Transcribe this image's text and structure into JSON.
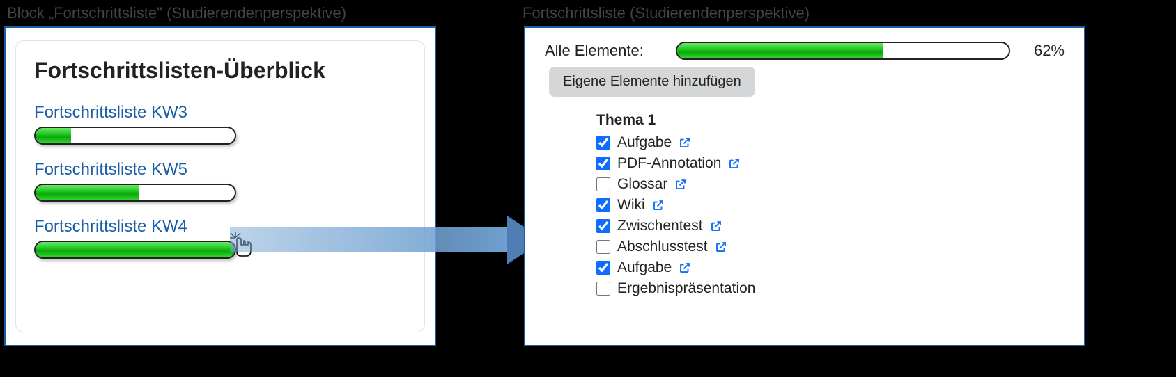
{
  "captions": {
    "left": "Block „Fortschrittsliste\" (Studierendenperspektive)",
    "right": "Fortschrittsliste (Studierendenperspektive)"
  },
  "overview": {
    "title": "Fortschrittslisten-Überblick",
    "items": [
      {
        "label": "Fortschrittsliste KW3",
        "progress": 18
      },
      {
        "label": "Fortschrittsliste KW5",
        "progress": 52
      },
      {
        "label": "Fortschrittsliste KW4",
        "progress": 100
      }
    ]
  },
  "detail": {
    "all_label": "Alle Elemente:",
    "percent_label": "62%",
    "percent_value": 62,
    "add_button": "Eigene Elemente hinzufügen",
    "topic_title": "Thema 1",
    "items": [
      {
        "label": "Aufgabe",
        "checked": true,
        "has_link": true
      },
      {
        "label": "PDF-Annotation",
        "checked": true,
        "has_link": true
      },
      {
        "label": "Glossar",
        "checked": false,
        "has_link": true
      },
      {
        "label": "Wiki",
        "checked": true,
        "has_link": true
      },
      {
        "label": "Zwischentest",
        "checked": true,
        "has_link": true
      },
      {
        "label": "Abschlusstest",
        "checked": false,
        "has_link": true
      },
      {
        "label": "Aufgabe",
        "checked": true,
        "has_link": true
      },
      {
        "label": "Ergebnispräsentation",
        "checked": false,
        "has_link": false
      }
    ]
  },
  "colors": {
    "link_blue": "#1a5ea8",
    "icon_blue": "#0d6efd",
    "progress_green": "#1fc61f"
  }
}
